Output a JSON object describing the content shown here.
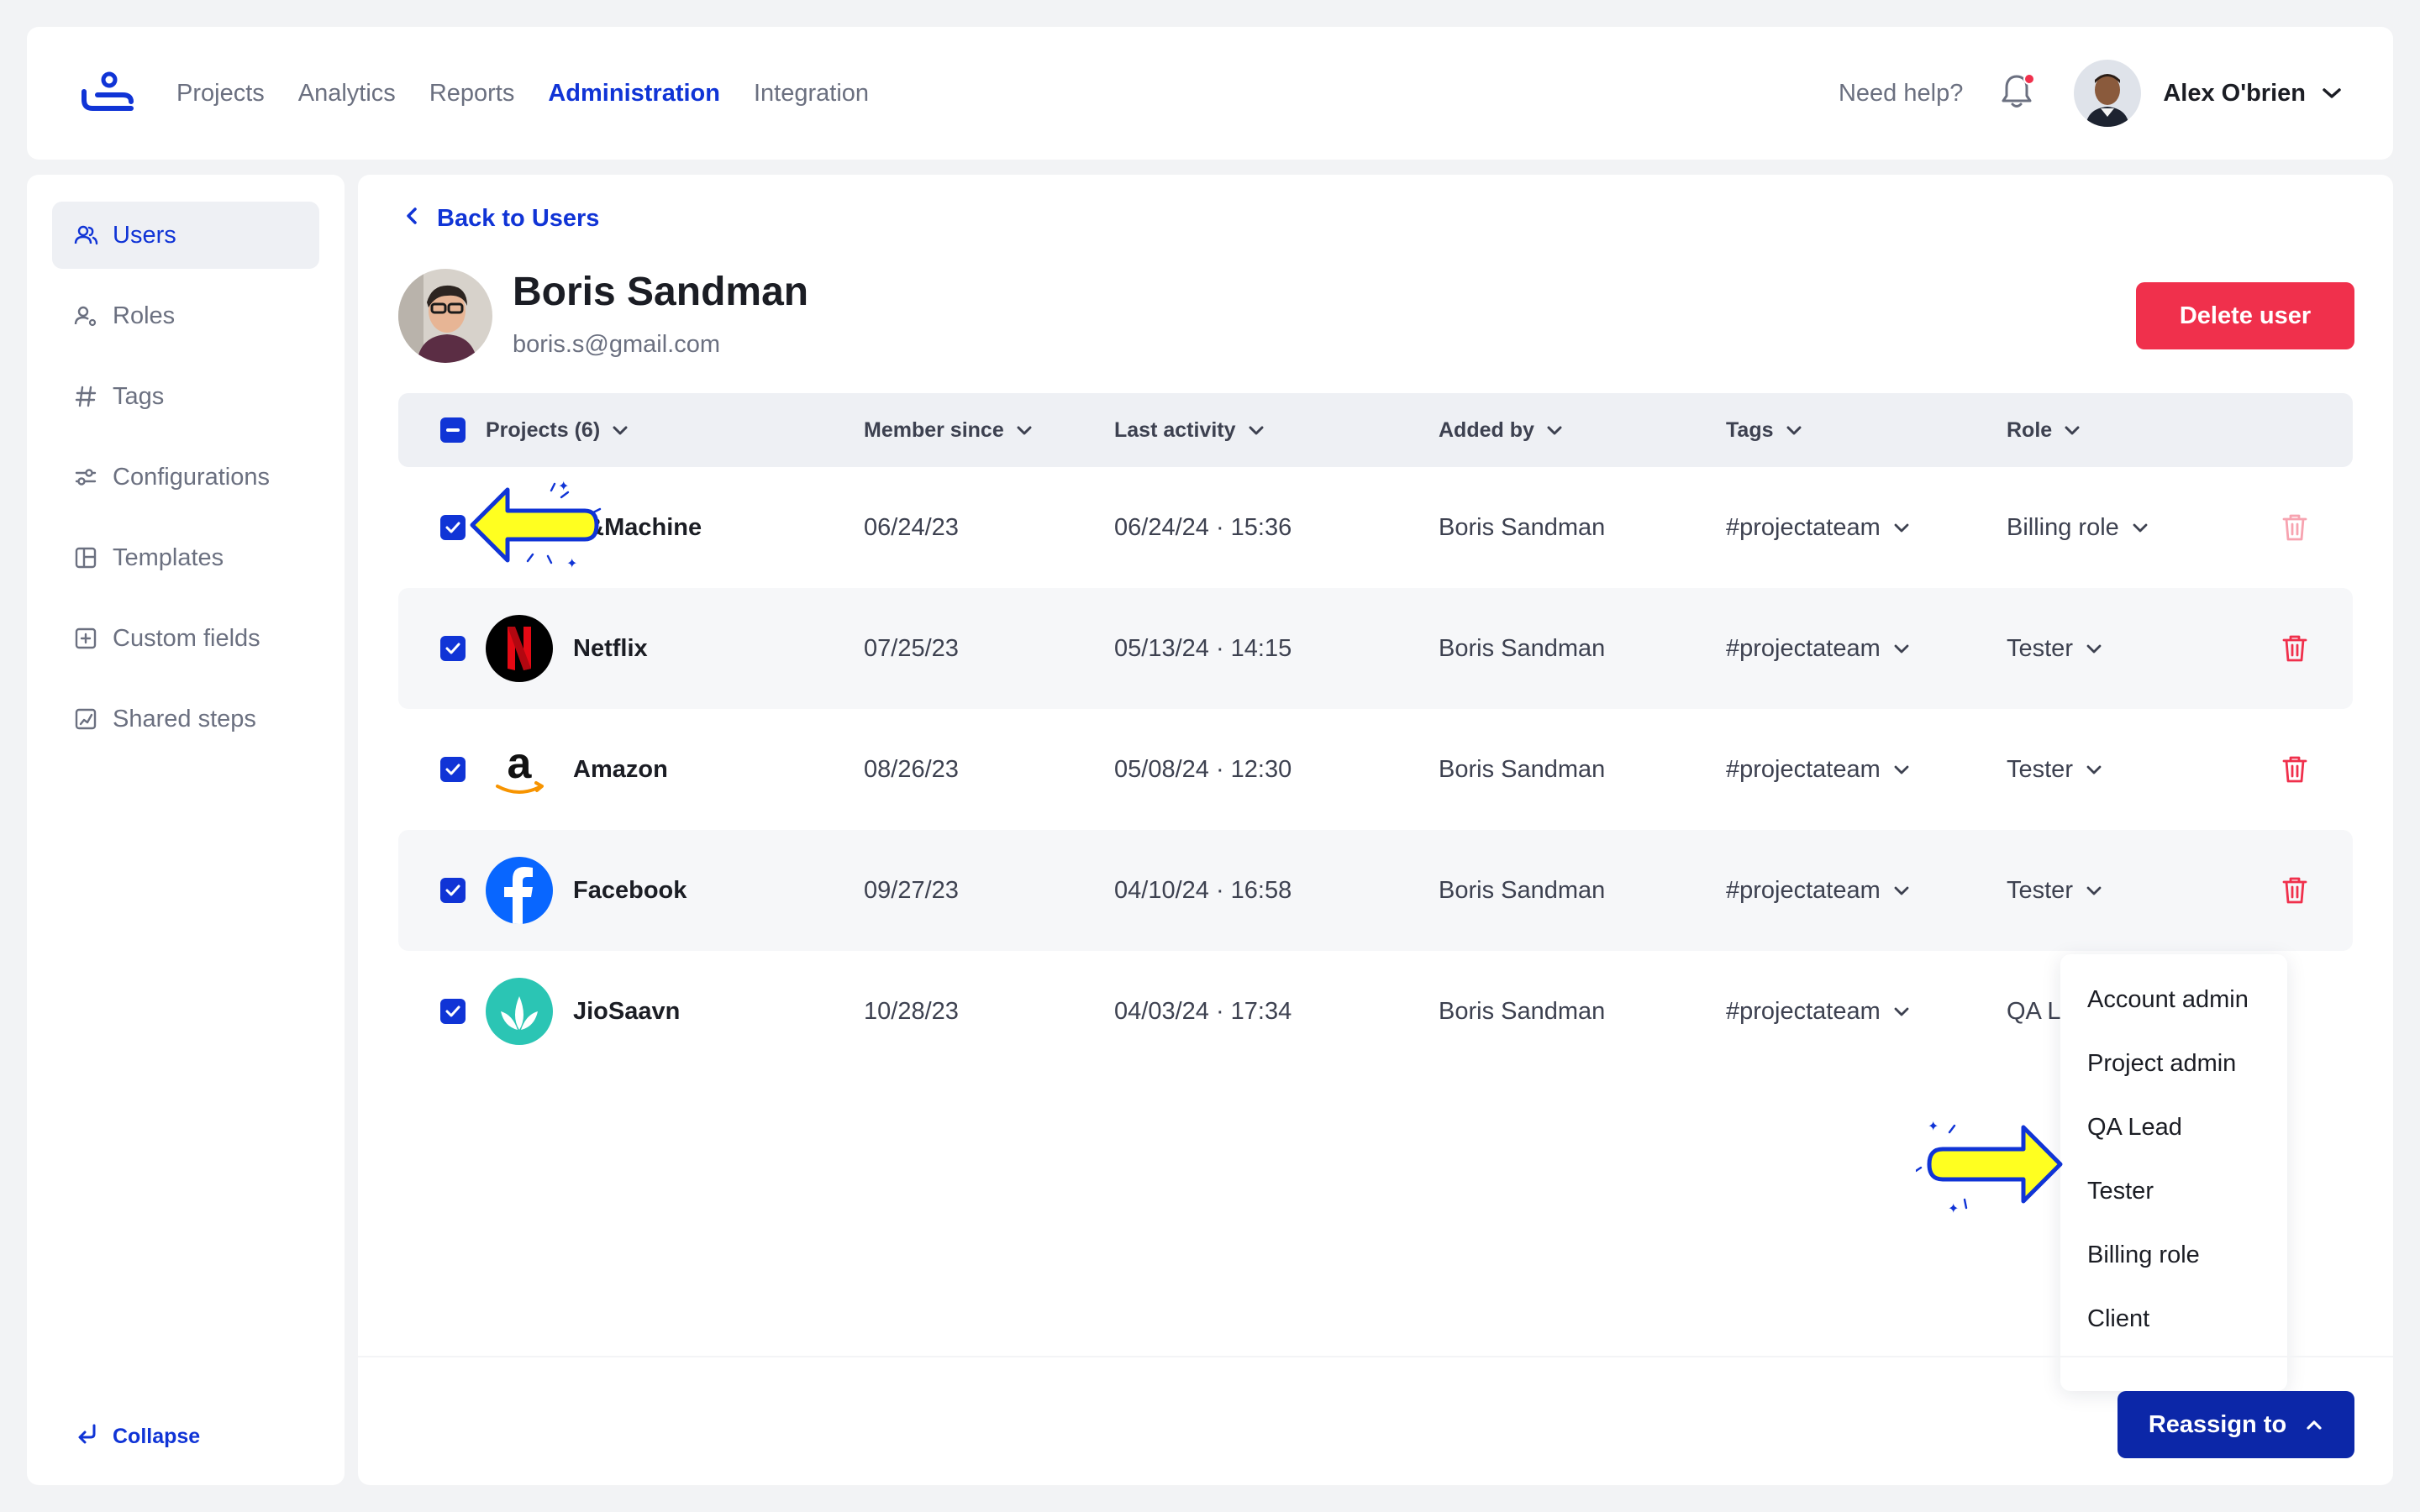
{
  "nav": {
    "items": [
      "Projects",
      "Analytics",
      "Reports",
      "Administration",
      "Integration"
    ],
    "active": "Administration",
    "help": "Need help?",
    "user_name": "Alex O'brien"
  },
  "sidebar": {
    "items": [
      {
        "label": "Users",
        "icon": "users-icon",
        "active": true
      },
      {
        "label": "Roles",
        "icon": "roles-icon"
      },
      {
        "label": "Tags",
        "icon": "hash-icon"
      },
      {
        "label": "Configurations",
        "icon": "sliders-icon"
      },
      {
        "label": "Templates",
        "icon": "template-icon"
      },
      {
        "label": "Custom fields",
        "icon": "plus-square-icon"
      },
      {
        "label": "Shared steps",
        "icon": "shared-steps-icon"
      }
    ],
    "collapse": "Collapse"
  },
  "profile": {
    "back": "Back to Users",
    "name": "Boris Sandman",
    "email": "boris.s@gmail.com",
    "delete": "Delete user"
  },
  "table": {
    "headers": [
      "Projects (6)",
      "Member since",
      "Last activity",
      "Added by",
      "Tags",
      "Role"
    ],
    "rows": [
      {
        "project": "e&Machine",
        "member_since": "06/24/23",
        "last_activity": "06/24/24 · 15:36",
        "added_by": "Boris Sandman",
        "tag": "#projectateam",
        "role": "Billing role"
      },
      {
        "project": "Netflix",
        "member_since": "07/25/23",
        "last_activity": "05/13/24 · 14:15",
        "added_by": "Boris Sandman",
        "tag": "#projectateam",
        "role": "Tester"
      },
      {
        "project": "Amazon",
        "member_since": "08/26/23",
        "last_activity": "05/08/24 · 12:30",
        "added_by": "Boris Sandman",
        "tag": "#projectateam",
        "role": "Tester"
      },
      {
        "project": "Facebook",
        "member_since": "09/27/23",
        "last_activity": "04/10/24 · 16:58",
        "added_by": "Boris Sandman",
        "tag": "#projectateam",
        "role": "Tester"
      },
      {
        "project": "JioSaavn",
        "member_since": "10/28/23",
        "last_activity": "04/03/24 · 17:34",
        "added_by": "Boris Sandman",
        "tag": "#projectateam",
        "role": "QA L"
      }
    ]
  },
  "role_menu": {
    "options": [
      "Account admin",
      "Project admin",
      "QA Lead",
      "Tester",
      "Billing role",
      "Client"
    ]
  },
  "footer": {
    "reassign": "Reassign to"
  },
  "colors": {
    "accent": "#1034d6",
    "danger": "#f0304c",
    "highlight": "#ffff20"
  }
}
